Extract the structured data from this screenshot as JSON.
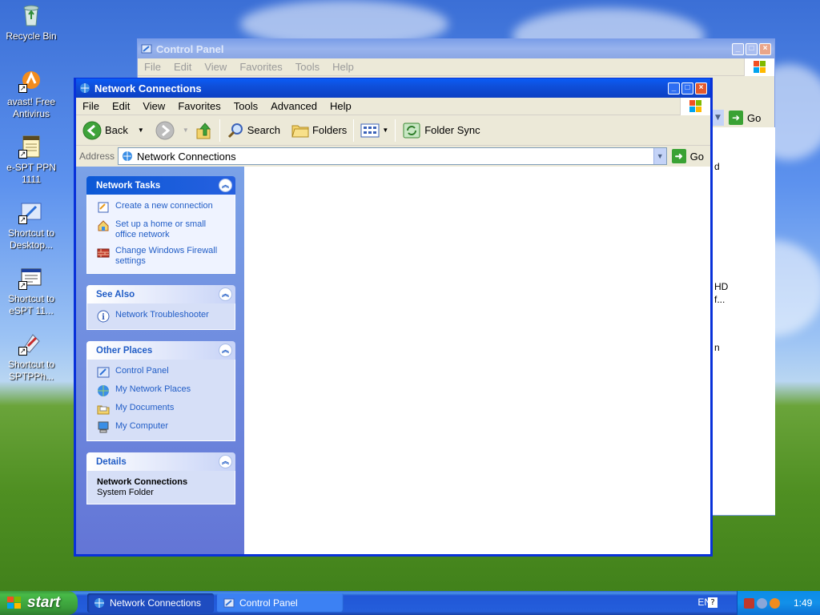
{
  "desktop": {
    "icons": [
      {
        "label": "Recycle Bin"
      },
      {
        "label": "avast! Free Antivirus"
      },
      {
        "label": "e-SPT PPN 1111"
      },
      {
        "label": "Shortcut to Desktop..."
      },
      {
        "label": "Shortcut to eSPT 11..."
      },
      {
        "label": "Shortcut to SPTPPh..."
      }
    ]
  },
  "back_window": {
    "title": "Control Panel",
    "menu": [
      "File",
      "Edit",
      "View",
      "Favorites",
      "Tools",
      "Help"
    ],
    "go_label": "Go",
    "partial_texts": [
      "d",
      "HD",
      "f...",
      "n"
    ]
  },
  "window": {
    "title": "Network Connections",
    "menu": [
      "File",
      "Edit",
      "View",
      "Favorites",
      "Tools",
      "Advanced",
      "Help"
    ],
    "toolbar": {
      "back": "Back",
      "search": "Search",
      "folders": "Folders",
      "folder_sync": "Folder Sync"
    },
    "address": {
      "label": "Address",
      "value": "Network Connections",
      "go": "Go"
    },
    "panels": {
      "network_tasks": {
        "title": "Network Tasks",
        "items": [
          "Create a new connection",
          "Set up a home or small office network",
          "Change Windows Firewall settings"
        ]
      },
      "see_also": {
        "title": "See Also",
        "items": [
          "Network Troubleshooter"
        ]
      },
      "other_places": {
        "title": "Other Places",
        "items": [
          "Control Panel",
          "My Network Places",
          "My Documents",
          "My Computer"
        ]
      },
      "details": {
        "title": "Details",
        "name": "Network Connections",
        "type": "System Folder"
      }
    }
  },
  "taskbar": {
    "start": "start",
    "tasks": [
      "Network Connections",
      "Control Panel"
    ],
    "language": "EN",
    "clock": "1:49"
  },
  "colors": {
    "title_active": "#0b4fd9",
    "task_link": "#215dc6",
    "start_green": "#3a9d3a"
  }
}
